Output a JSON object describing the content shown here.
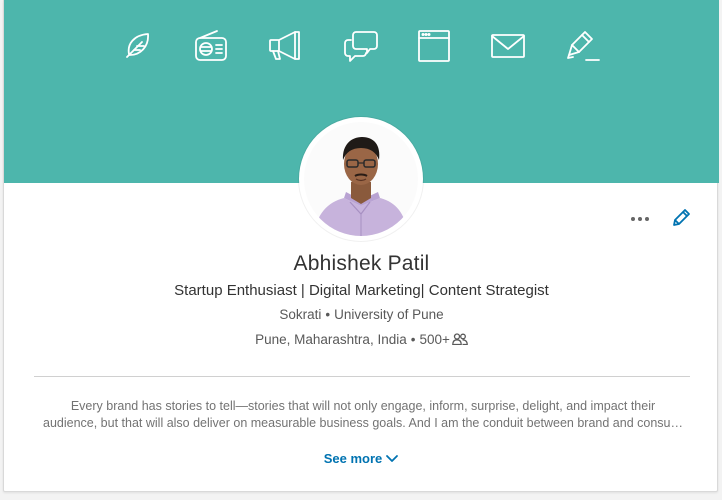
{
  "profile": {
    "name": "Abhishek Patil",
    "headline": "Startup Enthusiast | Digital Marketing| Content Strategist",
    "company": "Sokrati",
    "school": "University of Pune",
    "location": "Pune, Maharashtra, India",
    "connections": "500+",
    "separator": "•"
  },
  "summary": {
    "line1": "Every brand has stories to tell—stories that will not only engage, inform, surprise, delight, and impact their",
    "line2": "audience, but that will also deliver on measurable business goals. And I am the conduit between brand and consu…",
    "see_more_label": "See more"
  },
  "icons": {
    "banner": [
      "feather-icon",
      "radio-icon",
      "megaphone-icon",
      "chat-bubbles-icon",
      "browser-window-icon",
      "envelope-icon",
      "marker-pen-icon"
    ],
    "more": "more-dots-icon",
    "edit": "pencil-icon",
    "connections": "people-icon",
    "see_more": "chevron-down-icon"
  },
  "colors": {
    "banner": "#4db6ac",
    "accent": "#0073b1",
    "banner_icon_stroke": "#ffffff"
  }
}
